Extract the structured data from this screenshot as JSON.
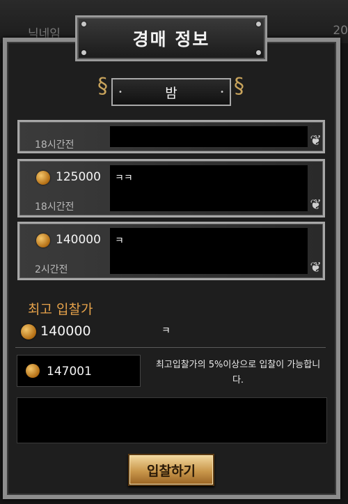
{
  "background": {
    "left_text": "닉네임",
    "right_text": "20"
  },
  "dialog": {
    "title": "경매 정보"
  },
  "time_filter": {
    "selected": "밤"
  },
  "bids": [
    {
      "amount": "",
      "comment": "",
      "time_ago": "18시간전"
    },
    {
      "amount": "125000",
      "comment": "ㅋㅋ",
      "time_ago": "18시간전"
    },
    {
      "amount": "140000",
      "comment": "ㅋ",
      "time_ago": "2시간전"
    }
  ],
  "highest_bid": {
    "label": "최고 입찰가",
    "amount": "140000",
    "comment": "ㅋ"
  },
  "bid_input": {
    "value": "147001"
  },
  "notice": "최고입찰가의 5%이상으로 입찰이 가능합니다.",
  "message": {
    "value": ""
  },
  "actions": {
    "bid_label": "입찰하기"
  },
  "colors": {
    "accent": "#e6a24a",
    "button": "#c9974b",
    "frame": "#8d8d8d"
  },
  "icons": {
    "currency": "gold-coin-icon"
  }
}
